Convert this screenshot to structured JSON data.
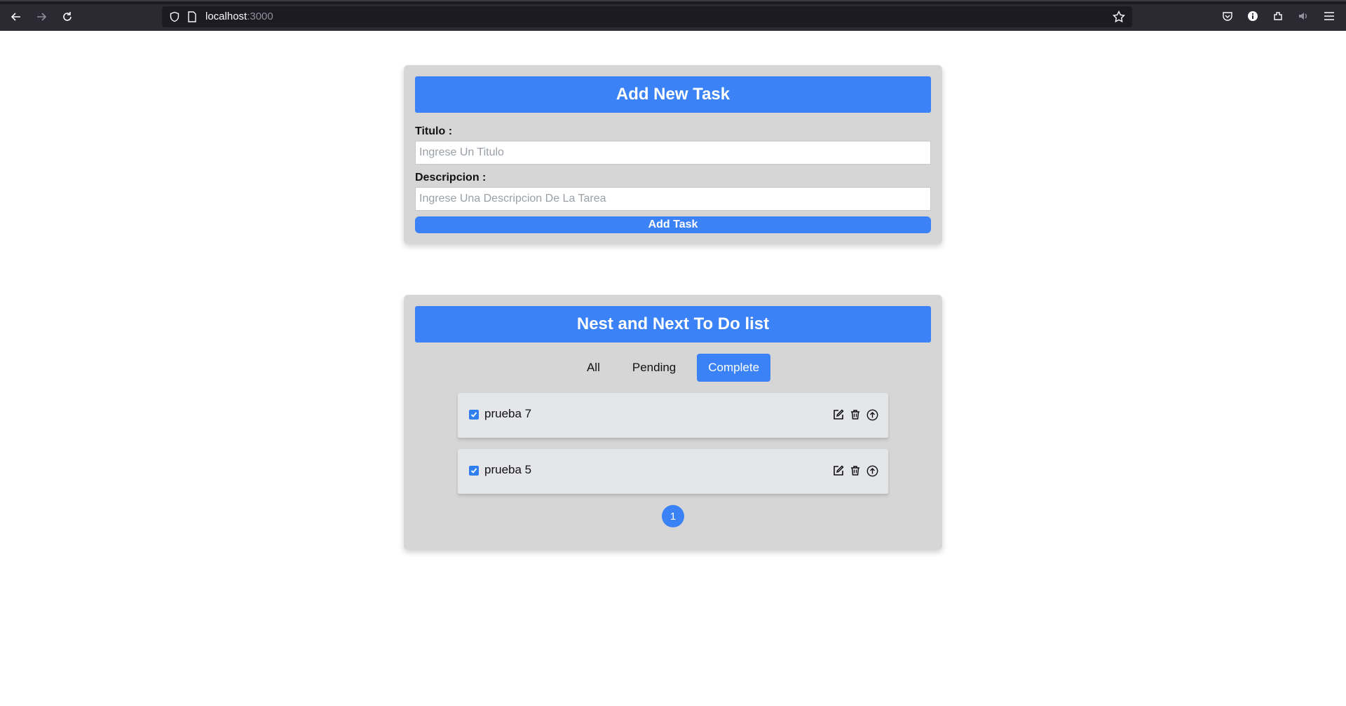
{
  "browser": {
    "url_host": "localhost",
    "url_port": ":3000"
  },
  "add_form": {
    "title": "Add New Task",
    "titulo_label": "Titulo :",
    "titulo_placeholder": "Ingrese Un Titulo",
    "descripcion_label": "Descripcion :",
    "descripcion_placeholder": "Ingrese Una Descripcion De La Tarea",
    "submit_label": "Add Task"
  },
  "todo_list": {
    "title": "Nest and Next To Do list",
    "filters": [
      {
        "label": "All",
        "active": false
      },
      {
        "label": "Pending",
        "active": false
      },
      {
        "label": "Complete",
        "active": true
      }
    ],
    "tasks": [
      {
        "title": "prueba 7",
        "completed": true
      },
      {
        "title": "prueba 5",
        "completed": true
      }
    ],
    "pagination": {
      "current_page": "1"
    }
  },
  "colors": {
    "accent": "#3b82f6",
    "panel": "#d6d6d6",
    "task_bg": "#e5e6ea"
  }
}
